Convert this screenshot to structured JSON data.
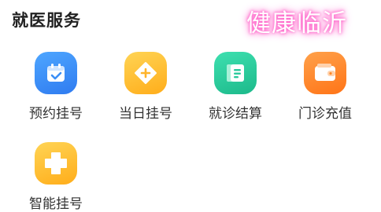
{
  "section": {
    "title": "就医服务"
  },
  "watermark": {
    "text": "健康临沂"
  },
  "services": [
    {
      "label": "预约挂号",
      "icon": "calendar-check-icon",
      "color": "#3b8ff6"
    },
    {
      "label": "当日挂号",
      "icon": "diamond-plus-icon",
      "color": "#ffbe2e"
    },
    {
      "label": "就诊结算",
      "icon": "document-list-icon",
      "color": "#26c99a"
    },
    {
      "label": "门诊充值",
      "icon": "wallet-icon",
      "color": "#ff8a2a"
    },
    {
      "label": "智能挂号",
      "icon": "plus-cross-icon",
      "color": "#ffbe2e"
    }
  ]
}
